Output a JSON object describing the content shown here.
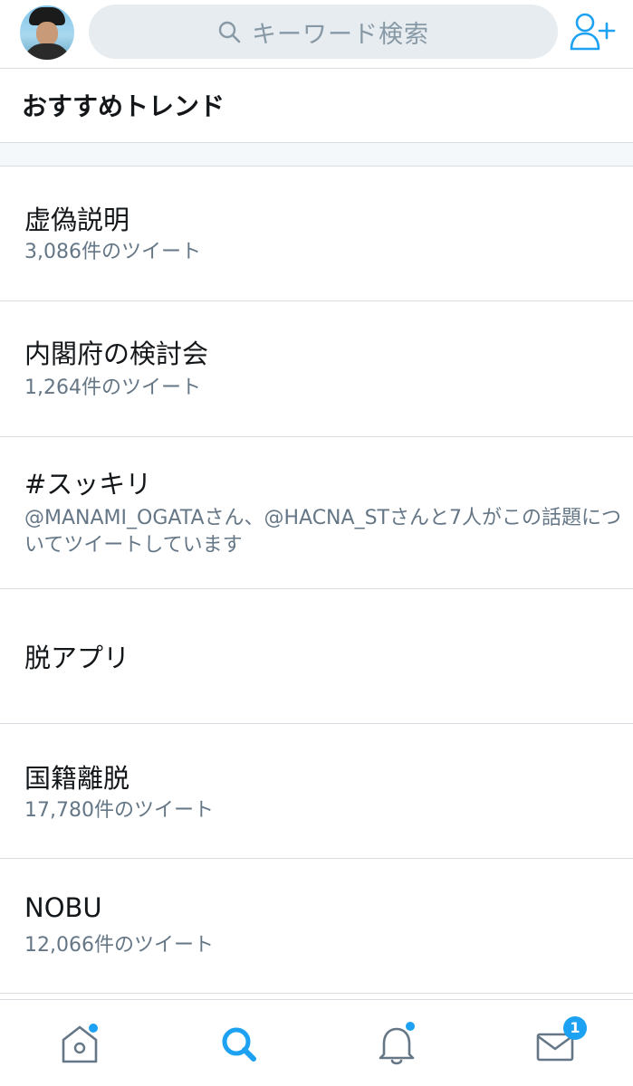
{
  "header": {
    "search_placeholder": "キーワード検索"
  },
  "section": {
    "title": "おすすめトレンド"
  },
  "trends": [
    {
      "name": "虚偽説明",
      "meta": "3,086件のツイート"
    },
    {
      "name": "内閣府の検討会",
      "meta": "1,264件のツイート"
    },
    {
      "name": "#スッキリ",
      "meta": "@MANAMI_OGATAさん、@HACNA_STさんと7人がこの話題についてツイートしています"
    },
    {
      "name": "脱アプリ",
      "meta": ""
    },
    {
      "name": "国籍離脱",
      "meta": "17,780件のツイート"
    },
    {
      "name": "NOBU",
      "meta": "12,066件のツイート"
    }
  ],
  "tabbar": {
    "messages_badge": "1"
  },
  "colors": {
    "accent": "#1da1f2",
    "muted_text": "#657786",
    "search_bg": "#e6ecf0",
    "divider": "#d9dde1"
  },
  "icons": {
    "avatar": "profile-photo",
    "search": "magnifier-icon",
    "add_user": "person-plus-icon",
    "home": "home-icon",
    "explore": "search-icon",
    "notifications": "bell-icon",
    "messages": "envelope-icon"
  }
}
